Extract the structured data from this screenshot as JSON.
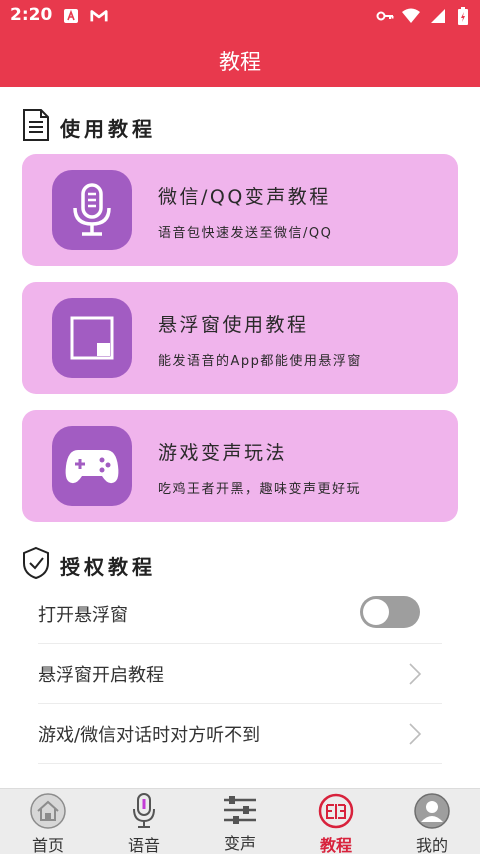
{
  "status_bar": {
    "time": "2:20",
    "left_icons": [
      "a-badge-icon",
      "gmail-icon"
    ],
    "right_icons": [
      "key-icon",
      "wifi-icon",
      "signal-icon",
      "battery-icon"
    ]
  },
  "header": {
    "title": "教程"
  },
  "tutorial_section": {
    "title": "使用教程",
    "icon": "document-icon",
    "cards": [
      {
        "title": "微信/QQ变声教程",
        "subtitle": "语音包快速发送至微信/QQ",
        "icon": "microphone-icon"
      },
      {
        "title": "悬浮窗使用教程",
        "subtitle": "能发语音的App都能使用悬浮窗",
        "icon": "floating-window-icon"
      },
      {
        "title": "游戏变声玩法",
        "subtitle": "吃鸡王者开黑，趣味变声更好玩",
        "icon": "gamepad-icon"
      }
    ]
  },
  "auth_section": {
    "title": "授权教程",
    "icon": "shield-check-icon",
    "rows": [
      {
        "label": "打开悬浮窗",
        "control": "toggle",
        "toggle_on": false
      },
      {
        "label": "悬浮窗开启教程",
        "control": "chevron"
      },
      {
        "label": "游戏/微信对话时对方听不到",
        "control": "chevron"
      }
    ]
  },
  "bottom_nav": {
    "active_index": 3,
    "items": [
      {
        "label": "首页",
        "icon": "home-icon"
      },
      {
        "label": "语音",
        "icon": "microphone-icon"
      },
      {
        "label": "变声",
        "icon": "sliders-icon"
      },
      {
        "label": "教程",
        "icon": "tutorial-book-icon"
      },
      {
        "label": "我的",
        "icon": "user-avatar-icon"
      }
    ]
  },
  "colors": {
    "primary": "#e8394d",
    "card_bg": "#f0b4ec",
    "icon_bg": "#a25cc2",
    "active_nav": "#d8223c"
  }
}
